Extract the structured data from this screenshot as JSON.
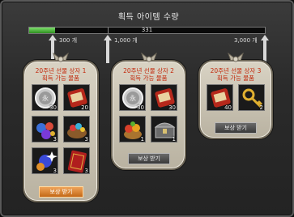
{
  "window": {
    "title": "획득 아이템 수량"
  },
  "progress": {
    "value": 331,
    "value_label": "331",
    "max": 3000,
    "milestones": [
      {
        "label": "300 개",
        "value": 300
      },
      {
        "label": "1,000 개",
        "value": 1000
      },
      {
        "label": "3,000 개",
        "value": 3000
      }
    ]
  },
  "boxes": [
    {
      "title1": "20주년 선물 상자 1",
      "title2": "획득 가능 물품",
      "items": [
        {
          "icon": "silver-coin-icon",
          "qty": "30"
        },
        {
          "icon": "red-scroll-icon",
          "qty": "20"
        },
        {
          "icon": "colored-orbs-icon",
          "qty": "3"
        },
        {
          "icon": "gem-basket-icon",
          "qty": "3"
        },
        {
          "icon": "sparkle-orb-icon",
          "qty": "3"
        },
        {
          "icon": "red-card-icon",
          "qty": "3"
        }
      ],
      "button": "보상 받기"
    },
    {
      "title1": "20주년 선물 상자 2",
      "title2": "획득 가능 물품",
      "items": [
        {
          "icon": "silver-coin-icon",
          "qty": "30"
        },
        {
          "icon": "red-scroll-icon",
          "qty": "30"
        },
        {
          "icon": "fruit-basket-icon",
          "qty": "1"
        },
        {
          "icon": "treasure-chest-icon",
          "qty": "1"
        }
      ],
      "button": "보상 받기"
    },
    {
      "title1": "20주년 선물 상자 3",
      "title2": "획득 가능 물품",
      "items": [
        {
          "icon": "red-scroll-icon",
          "qty": "40"
        },
        {
          "icon": "golden-key-icon",
          "qty": "2"
        }
      ],
      "button": "보상 받기"
    }
  ]
}
